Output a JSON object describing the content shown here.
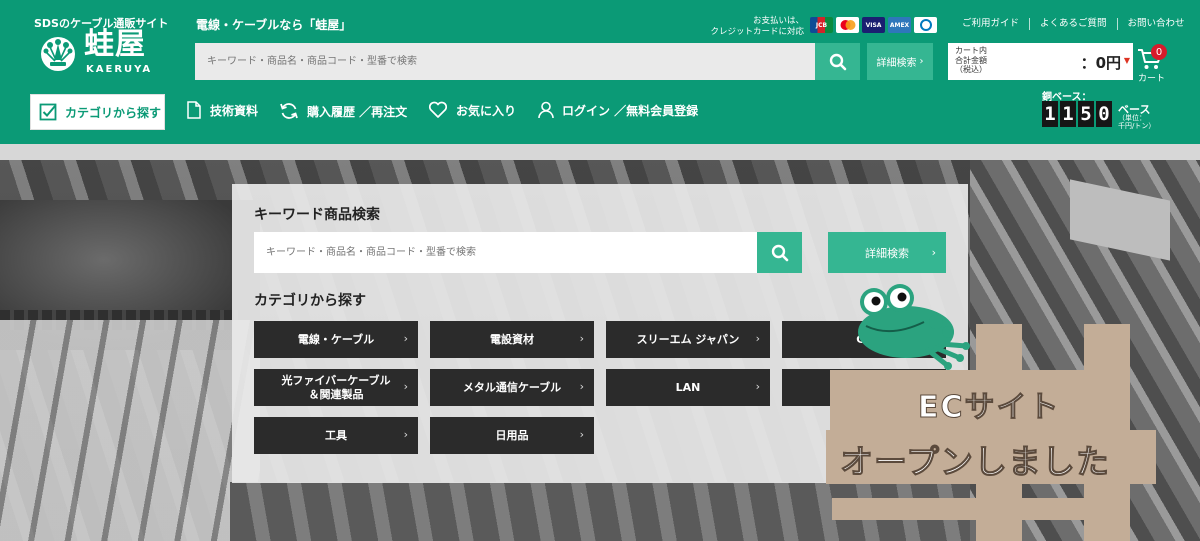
{
  "header": {
    "tagline_small": "SDSのケーブル通販サイト",
    "logo_name": "蛙屋",
    "logo_roman": "KAERUYA",
    "tagline": "電線・ケーブルなら「蛙屋」",
    "search_placeholder": "キーワード・商品名・商品コード・型番で検索",
    "detail_search": "詳細検索",
    "payment_text_line1": "お支払いは、",
    "payment_text_line2": "クレジットカードに対応",
    "cards": [
      "JCB",
      "MC",
      "VISA",
      "AMEX",
      "Diners"
    ],
    "top_links": [
      "ご利用ガイド",
      "よくあるご質問",
      "お問い合わせ"
    ],
    "cart_label_line1": "カート内",
    "cart_label_line2": "合計金額",
    "cart_label_line3": "（税込）",
    "cart_amount": "：0円",
    "cart_count": "0",
    "cart_text": "カート"
  },
  "nav": {
    "category": "カテゴリから探す",
    "tech": "技術資料",
    "history": "購入履歴 ／再注文",
    "favorites": "お気に入り",
    "login": "ログイン ／無料会員登録"
  },
  "copper": {
    "label": "銅ベース：",
    "digits": [
      "1",
      "1",
      "5",
      "0"
    ],
    "unit": "ベース",
    "note_line1": "（単位：",
    "note_line2": "千円/トン）"
  },
  "panel": {
    "title": "キーワード商品検索",
    "placeholder": "キーワード・商品名・商品コード・型番で検索",
    "detail_button": "詳細検索",
    "category_title": "カテゴリから探す",
    "categories": [
      {
        "line1": "電線・ケーブル",
        "line2": ""
      },
      {
        "line1": "電設資材",
        "line2": ""
      },
      {
        "line1": "スリーエム ジャパン",
        "line2": ""
      },
      {
        "line1": "CE",
        "line2": ""
      },
      {
        "line1": "光ファイバーケーブル",
        "line2": "＆関連製品"
      },
      {
        "line1": "メタル通信ケーブル",
        "line2": ""
      },
      {
        "line1": "LAN",
        "line2": ""
      },
      {
        "line1": "",
        "line2": ""
      },
      {
        "line1": "工具",
        "line2": ""
      },
      {
        "line1": "日用品",
        "line2": ""
      }
    ]
  },
  "banner": {
    "line1": "ECサイト",
    "line2": "オープンしました"
  },
  "colors": {
    "brand_green": "#0b9a76",
    "button_green": "#35b692",
    "cart_badge": "#d61b2b",
    "category_bg": "#2b2b2b",
    "board": "#c3ad97"
  }
}
